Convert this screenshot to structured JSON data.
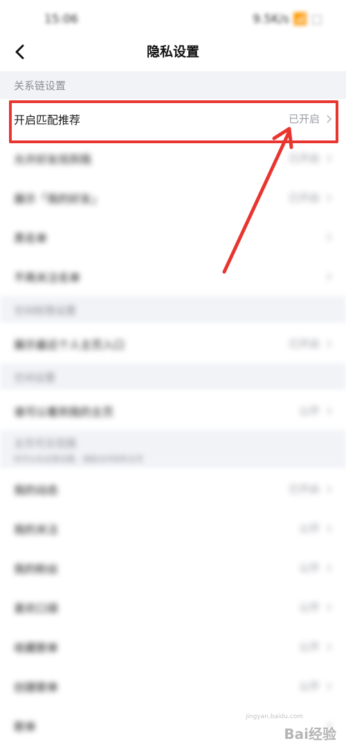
{
  "status_bar": {
    "time": "15:06",
    "right": "9.5K/s 📶 ⬚"
  },
  "nav": {
    "title": "隐私设置"
  },
  "sections": {
    "relation": "关系链设置",
    "s2": "空间权限设置",
    "s3": "空间设置",
    "s4": "主页可见范围",
    "s4_sub": "你可以在这里设置，谁能访问你的主页"
  },
  "rows": [
    {
      "label": "开启匹配推荐",
      "value": "已开启"
    },
    {
      "label": "允许好友找到我",
      "value": "已开启"
    },
    {
      "label": "展示「我的好友」",
      "value": "已开启"
    },
    {
      "label": "黑名单",
      "value": ""
    },
    {
      "label": "不再关注名单",
      "value": ""
    },
    {
      "label": "展示最近个人主页入口",
      "value": "已开启"
    },
    {
      "label": "谁可以看到我的主页",
      "value": "公开"
    },
    {
      "label": "我的动态",
      "value": "已开启"
    },
    {
      "label": "我的关注",
      "value": "公开"
    },
    {
      "label": "我的粉丝",
      "value": "公开"
    },
    {
      "label": "喜欢口袋",
      "value": "公开"
    },
    {
      "label": "收藏歌单",
      "value": "公开"
    },
    {
      "label": "创建歌单",
      "value": "公开"
    },
    {
      "label": "歌单",
      "value": ""
    }
  ],
  "watermark": {
    "brand": "Bai经验",
    "sub": "jingyan.baidu.com"
  },
  "colors": {
    "highlight": "#e8352f",
    "section_bg": "#f1f3f7"
  }
}
